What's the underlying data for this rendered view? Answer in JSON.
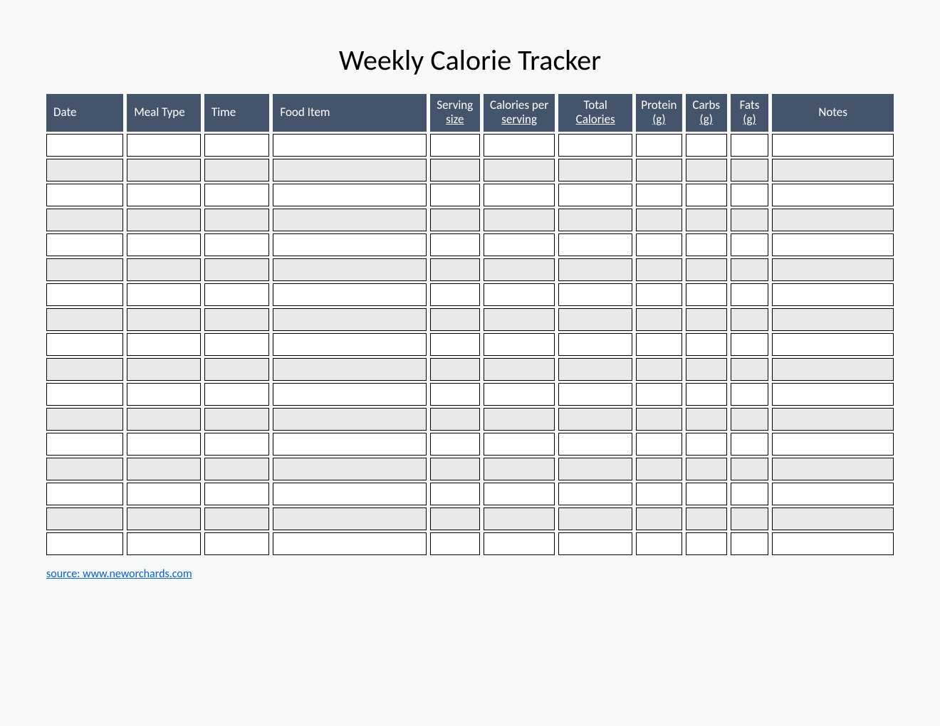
{
  "title": "Weekly Calorie Tracker",
  "columns": {
    "date": "Date",
    "meal_type": "Meal Type",
    "time": "Time",
    "food_item": "Food Item",
    "serving_size_1": "Serving",
    "serving_size_2": "size",
    "cal_per_1": "Calories per",
    "cal_per_2": "serving",
    "total_1": "Total",
    "total_2": "Calories",
    "protein_1": "Protein",
    "protein_2": "(g)",
    "carbs_1": "Carbs",
    "carbs_2": "(g)",
    "fats_1": "Fats",
    "fats_2": "(g)",
    "notes": "Notes"
  },
  "row_count": 17,
  "source_label": "source: www.neworchards.com",
  "source_url": "http://www.neworchards.com"
}
